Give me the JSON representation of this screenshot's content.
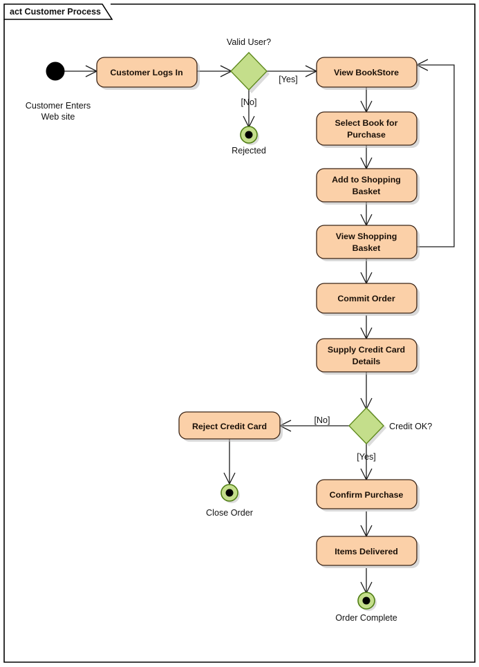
{
  "frame": {
    "tab_label": "act Customer Process",
    "border_color": "#000000",
    "background": "#ffffff"
  },
  "palette": {
    "activity_fill": "#fbd0a8",
    "activity_stroke": "#3b2415",
    "decision_fill": "#c4de8b",
    "decision_stroke": "#5f8a1e",
    "final_fill": "#c4de8b",
    "final_stroke": "#4f7d14",
    "initial_fill": "#000000",
    "flow_stroke": "#1a1a1a"
  },
  "nodes": {
    "initial": {
      "type": "initial-node",
      "caption_line1": "Customer Enters",
      "caption_line2": "Web site"
    },
    "customer_logs_in": {
      "type": "activity",
      "label": "Customer Logs In"
    },
    "valid_user_decision": {
      "type": "decision",
      "caption": "Valid User?"
    },
    "rejected_final": {
      "type": "activity-final",
      "caption": "Rejected"
    },
    "view_bookstore": {
      "type": "activity",
      "label": "View BookStore"
    },
    "select_book": {
      "type": "activity",
      "label_line1": "Select Book for",
      "label_line2": "Purchase"
    },
    "add_to_basket": {
      "type": "activity",
      "label_line1": "Add to Shopping",
      "label_line2": "Basket"
    },
    "view_basket": {
      "type": "activity",
      "label_line1": "View Shopping",
      "label_line2": "Basket"
    },
    "commit_order": {
      "type": "activity",
      "label": "Commit Order"
    },
    "supply_credit_card": {
      "type": "activity",
      "label_line1": "Supply Credit Card",
      "label_line2": "Details"
    },
    "credit_ok_decision": {
      "type": "decision",
      "caption": "Credit OK?"
    },
    "reject_credit_card": {
      "type": "activity",
      "label": "Reject Credit Card"
    },
    "close_order_final": {
      "type": "activity-final",
      "caption": "Close Order"
    },
    "confirm_purchase": {
      "type": "activity",
      "label": "Confirm Purchase"
    },
    "items_delivered": {
      "type": "activity",
      "label": "Items Delivered"
    },
    "order_complete_final": {
      "type": "activity-final",
      "caption": "Order Complete"
    }
  },
  "guards": {
    "valid_user_yes": "[Yes]",
    "valid_user_no": "[No]",
    "credit_ok_yes": "[Yes]",
    "credit_ok_no": "[No]"
  }
}
